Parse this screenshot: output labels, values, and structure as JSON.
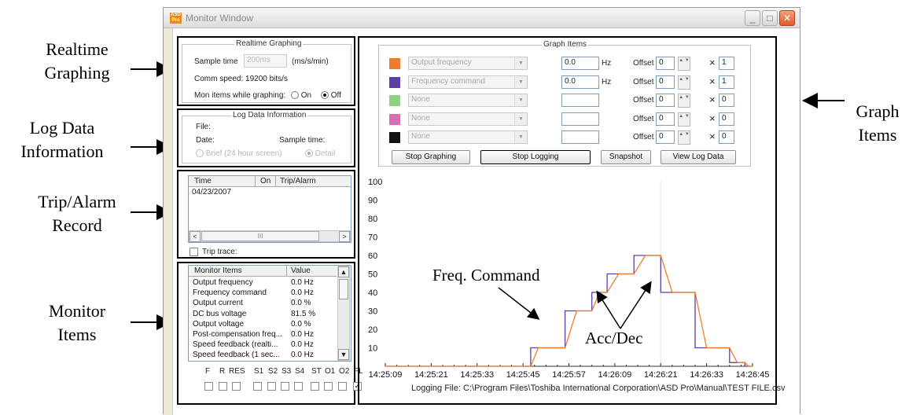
{
  "callouts": {
    "realtime": [
      "Realtime",
      "Graphing"
    ],
    "logdata": [
      "Log Data",
      "Information"
    ],
    "trip": [
      "Trip/Alarm",
      "Record"
    ],
    "monitor": [
      "Monitor",
      "Items"
    ],
    "graphitems": [
      "Graph",
      "Items"
    ]
  },
  "window": {
    "title": "Monitor Window",
    "icon_text": "ASD Pro"
  },
  "realtime": {
    "group_title": "Realtime Graphing",
    "sample_time_label": "Sample time",
    "sample_time_value": "200ms",
    "sample_time_unit": "(ms/s/min)",
    "comm_speed_label": "Comm speed:",
    "comm_speed_value": "19200",
    "comm_speed_unit": "bits/s",
    "mon_items_label": "Mon items while graphing:",
    "on_label": "On",
    "off_label": "Off",
    "selected": "Off"
  },
  "logdata": {
    "group_title": "Log Data Information",
    "file_label": "File:",
    "date_label": "Date:",
    "sample_time_label": "Sample time:",
    "brief_label": "Brief (24 hour screen)",
    "detail_label": "Detail",
    "selected": "Detail"
  },
  "trip": {
    "columns": [
      "Time",
      "On",
      "Trip/Alarm"
    ],
    "rows": [
      "04/23/2007"
    ],
    "scroll_mid": "III",
    "trace_label": "Trip trace:"
  },
  "monitor_items": {
    "columns": [
      "Monitor Items",
      "Value"
    ],
    "rows": [
      {
        "name": "Output frequency",
        "value": "0.0 Hz"
      },
      {
        "name": "Frequency command",
        "value": "0.0 Hz"
      },
      {
        "name": "Output current",
        "value": "0.0 %"
      },
      {
        "name": "DC bus voltage",
        "value": "81.5 %"
      },
      {
        "name": "Output voltage",
        "value": "0.0 %"
      },
      {
        "name": "Post-compensation freq...",
        "value": "0.0 Hz"
      },
      {
        "name": "Speed feedback (realti...",
        "value": "0.0 Hz"
      },
      {
        "name": "Speed feedback (1 sec...",
        "value": "0.0 Hz"
      }
    ],
    "terminals": [
      "F",
      "R",
      "RES",
      "S1",
      "S2",
      "S3",
      "S4",
      "ST",
      "O1",
      "O2",
      "FL"
    ],
    "terminal_checked": [
      false,
      false,
      false,
      false,
      false,
      false,
      false,
      false,
      false,
      false,
      true
    ]
  },
  "graph_items": {
    "group_title": "Graph Items",
    "offset_label": "Offset",
    "times_symbol": "×",
    "rows": [
      {
        "color": "#f07c2b",
        "item": "Output frequency",
        "value": "0.0",
        "unit": "Hz",
        "offset": "0",
        "mult": "1"
      },
      {
        "color": "#5b3fa6",
        "item": "Frequency command",
        "value": "0.0",
        "unit": "Hz",
        "offset": "0",
        "mult": "1"
      },
      {
        "color": "#8ed07f",
        "item": "None",
        "value": "",
        "unit": "",
        "offset": "0",
        "mult": "0"
      },
      {
        "color": "#d96fb1",
        "item": "None",
        "value": "",
        "unit": "",
        "offset": "0",
        "mult": "0"
      },
      {
        "color": "#111111",
        "item": "None",
        "value": "",
        "unit": "",
        "offset": "0",
        "mult": "0"
      }
    ],
    "buttons": {
      "stop_graphing": "Stop Graphing",
      "stop_logging": "Stop Logging",
      "snapshot": "Snapshot",
      "view_log": "View Log Data"
    }
  },
  "annotations": {
    "freq_command": "Freq. Command",
    "accdec": "Acc/Dec"
  },
  "chart_data": {
    "type": "line",
    "ylim": [
      0,
      100
    ],
    "yticks": [
      10,
      20,
      30,
      40,
      50,
      60,
      70,
      80,
      90,
      100
    ],
    "xticks": [
      "14:25:09",
      "14:25:21",
      "14:25:33",
      "14:25:45",
      "14:25:57",
      "14:26:09",
      "14:26:21",
      "14:26:33",
      "14:26:45"
    ],
    "xlim_seconds_after_first_tick": [
      0,
      96
    ],
    "series": [
      {
        "color": "#5b3fa6",
        "points": [
          [
            0,
            0
          ],
          [
            36,
            0
          ],
          [
            38,
            0
          ],
          [
            38,
            10
          ],
          [
            47,
            10
          ],
          [
            47,
            30
          ],
          [
            54,
            30
          ],
          [
            54,
            40
          ],
          [
            58,
            40
          ],
          [
            58,
            50
          ],
          [
            65,
            50
          ],
          [
            65,
            60
          ],
          [
            72,
            60
          ],
          [
            72,
            40
          ],
          [
            81,
            40
          ],
          [
            81,
            10
          ],
          [
            90,
            10
          ],
          [
            90,
            2
          ],
          [
            94,
            2
          ],
          [
            94,
            0
          ],
          [
            96,
            0
          ]
        ]
      },
      {
        "color": "#f07c2b",
        "points": [
          [
            0,
            0
          ],
          [
            36,
            0
          ],
          [
            38,
            0
          ],
          [
            40,
            10
          ],
          [
            47,
            10
          ],
          [
            50,
            30
          ],
          [
            54,
            30
          ],
          [
            56,
            40
          ],
          [
            58,
            40
          ],
          [
            61,
            50
          ],
          [
            65,
            50
          ],
          [
            68,
            60
          ],
          [
            72,
            60
          ],
          [
            75,
            40
          ],
          [
            81,
            40
          ],
          [
            84,
            10
          ],
          [
            90,
            10
          ],
          [
            92,
            2
          ],
          [
            94,
            2
          ],
          [
            95,
            0
          ],
          [
            96,
            0
          ]
        ]
      }
    ],
    "footer": "Logging File: C:\\Program Files\\Toshiba International Corporation\\ASD Pro\\Manual\\TEST FILE.csv"
  }
}
